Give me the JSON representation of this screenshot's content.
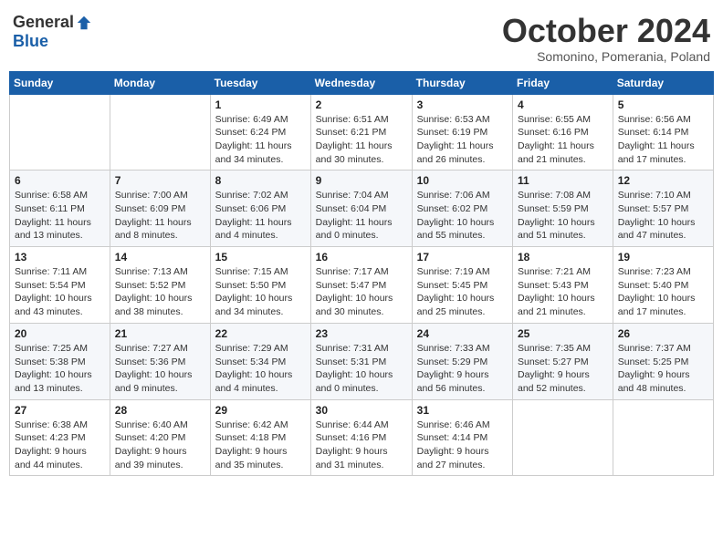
{
  "header": {
    "logo_general": "General",
    "logo_blue": "Blue",
    "month_title": "October 2024",
    "subtitle": "Somonino, Pomerania, Poland"
  },
  "days_of_week": [
    "Sunday",
    "Monday",
    "Tuesday",
    "Wednesday",
    "Thursday",
    "Friday",
    "Saturday"
  ],
  "weeks": [
    [
      {
        "day": "",
        "info": ""
      },
      {
        "day": "",
        "info": ""
      },
      {
        "day": "1",
        "info": "Sunrise: 6:49 AM\nSunset: 6:24 PM\nDaylight: 11 hours\nand 34 minutes."
      },
      {
        "day": "2",
        "info": "Sunrise: 6:51 AM\nSunset: 6:21 PM\nDaylight: 11 hours\nand 30 minutes."
      },
      {
        "day": "3",
        "info": "Sunrise: 6:53 AM\nSunset: 6:19 PM\nDaylight: 11 hours\nand 26 minutes."
      },
      {
        "day": "4",
        "info": "Sunrise: 6:55 AM\nSunset: 6:16 PM\nDaylight: 11 hours\nand 21 minutes."
      },
      {
        "day": "5",
        "info": "Sunrise: 6:56 AM\nSunset: 6:14 PM\nDaylight: 11 hours\nand 17 minutes."
      }
    ],
    [
      {
        "day": "6",
        "info": "Sunrise: 6:58 AM\nSunset: 6:11 PM\nDaylight: 11 hours\nand 13 minutes."
      },
      {
        "day": "7",
        "info": "Sunrise: 7:00 AM\nSunset: 6:09 PM\nDaylight: 11 hours\nand 8 minutes."
      },
      {
        "day": "8",
        "info": "Sunrise: 7:02 AM\nSunset: 6:06 PM\nDaylight: 11 hours\nand 4 minutes."
      },
      {
        "day": "9",
        "info": "Sunrise: 7:04 AM\nSunset: 6:04 PM\nDaylight: 11 hours\nand 0 minutes."
      },
      {
        "day": "10",
        "info": "Sunrise: 7:06 AM\nSunset: 6:02 PM\nDaylight: 10 hours\nand 55 minutes."
      },
      {
        "day": "11",
        "info": "Sunrise: 7:08 AM\nSunset: 5:59 PM\nDaylight: 10 hours\nand 51 minutes."
      },
      {
        "day": "12",
        "info": "Sunrise: 7:10 AM\nSunset: 5:57 PM\nDaylight: 10 hours\nand 47 minutes."
      }
    ],
    [
      {
        "day": "13",
        "info": "Sunrise: 7:11 AM\nSunset: 5:54 PM\nDaylight: 10 hours\nand 43 minutes."
      },
      {
        "day": "14",
        "info": "Sunrise: 7:13 AM\nSunset: 5:52 PM\nDaylight: 10 hours\nand 38 minutes."
      },
      {
        "day": "15",
        "info": "Sunrise: 7:15 AM\nSunset: 5:50 PM\nDaylight: 10 hours\nand 34 minutes."
      },
      {
        "day": "16",
        "info": "Sunrise: 7:17 AM\nSunset: 5:47 PM\nDaylight: 10 hours\nand 30 minutes."
      },
      {
        "day": "17",
        "info": "Sunrise: 7:19 AM\nSunset: 5:45 PM\nDaylight: 10 hours\nand 25 minutes."
      },
      {
        "day": "18",
        "info": "Sunrise: 7:21 AM\nSunset: 5:43 PM\nDaylight: 10 hours\nand 21 minutes."
      },
      {
        "day": "19",
        "info": "Sunrise: 7:23 AM\nSunset: 5:40 PM\nDaylight: 10 hours\nand 17 minutes."
      }
    ],
    [
      {
        "day": "20",
        "info": "Sunrise: 7:25 AM\nSunset: 5:38 PM\nDaylight: 10 hours\nand 13 minutes."
      },
      {
        "day": "21",
        "info": "Sunrise: 7:27 AM\nSunset: 5:36 PM\nDaylight: 10 hours\nand 9 minutes."
      },
      {
        "day": "22",
        "info": "Sunrise: 7:29 AM\nSunset: 5:34 PM\nDaylight: 10 hours\nand 4 minutes."
      },
      {
        "day": "23",
        "info": "Sunrise: 7:31 AM\nSunset: 5:31 PM\nDaylight: 10 hours\nand 0 minutes."
      },
      {
        "day": "24",
        "info": "Sunrise: 7:33 AM\nSunset: 5:29 PM\nDaylight: 9 hours\nand 56 minutes."
      },
      {
        "day": "25",
        "info": "Sunrise: 7:35 AM\nSunset: 5:27 PM\nDaylight: 9 hours\nand 52 minutes."
      },
      {
        "day": "26",
        "info": "Sunrise: 7:37 AM\nSunset: 5:25 PM\nDaylight: 9 hours\nand 48 minutes."
      }
    ],
    [
      {
        "day": "27",
        "info": "Sunrise: 6:38 AM\nSunset: 4:23 PM\nDaylight: 9 hours\nand 44 minutes."
      },
      {
        "day": "28",
        "info": "Sunrise: 6:40 AM\nSunset: 4:20 PM\nDaylight: 9 hours\nand 39 minutes."
      },
      {
        "day": "29",
        "info": "Sunrise: 6:42 AM\nSunset: 4:18 PM\nDaylight: 9 hours\nand 35 minutes."
      },
      {
        "day": "30",
        "info": "Sunrise: 6:44 AM\nSunset: 4:16 PM\nDaylight: 9 hours\nand 31 minutes."
      },
      {
        "day": "31",
        "info": "Sunrise: 6:46 AM\nSunset: 4:14 PM\nDaylight: 9 hours\nand 27 minutes."
      },
      {
        "day": "",
        "info": ""
      },
      {
        "day": "",
        "info": ""
      }
    ]
  ]
}
